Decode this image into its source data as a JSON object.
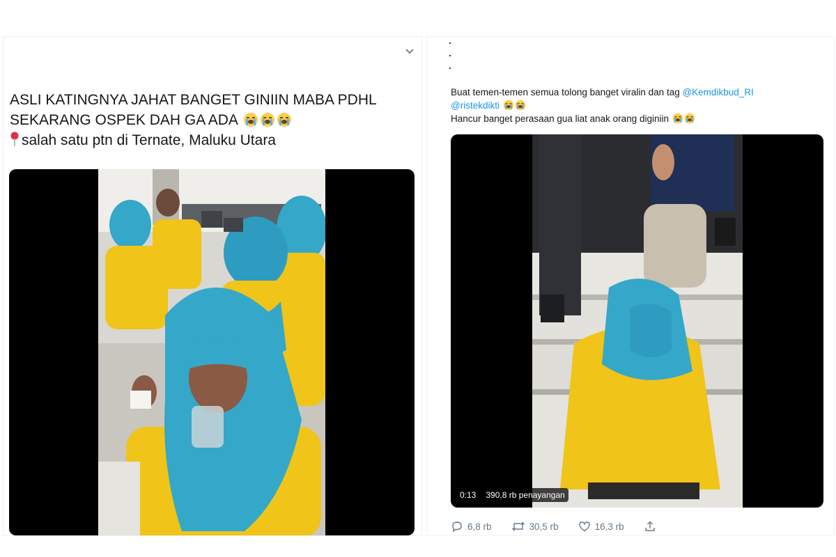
{
  "left_tweet": {
    "text_lines": [
      "ASLI KATINGNYA JAHAT BANGET GINIIN MABA PDHL",
      "SEKARANG OSPEK DAH GA ADA",
      "salah satu ptn di Ternate, Maluku Utara"
    ],
    "emoji_crying_count": 3,
    "menu_icon": "chevron-down-icon",
    "location_icon": "round-pushpin-icon"
  },
  "right_tweet": {
    "line1_text": "Buat temen-temen semua tolong banget viralin dan tag ",
    "mention1": "@Kemdikbud_RI",
    "mention2": "@ristekdikti",
    "line3_text": "Hancur banget perasaan gua liat anak orang diginiin",
    "video": {
      "duration": "0:13",
      "views": "390,8 rb penayangan"
    },
    "actions": {
      "reply_count": "6,8 rb",
      "retweet_count": "30,5 rb",
      "like_count": "16,3 rb"
    }
  },
  "colors": {
    "mention": "#1b95e0",
    "muted": "#657786",
    "hijab": "#35a7c9",
    "jacket": "#f0c419"
  }
}
